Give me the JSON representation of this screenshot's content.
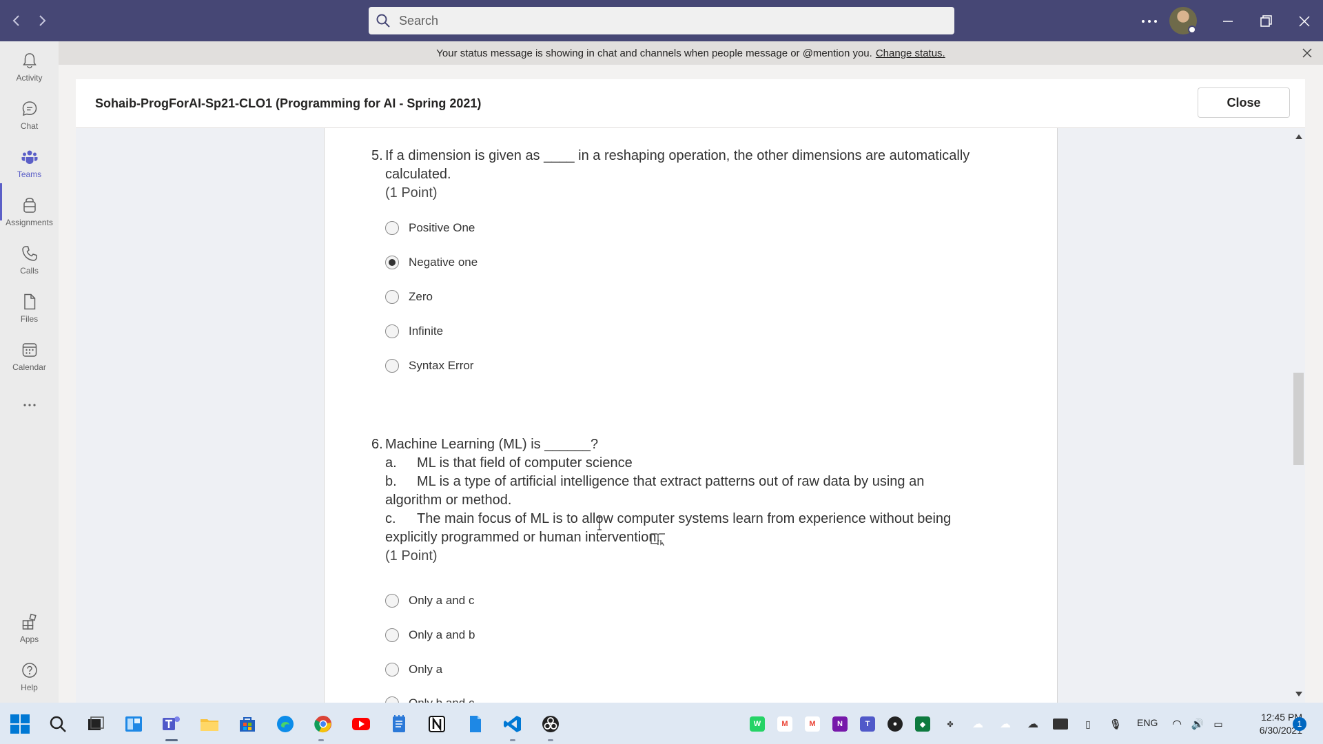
{
  "titlebar": {
    "search_placeholder": "Search"
  },
  "rail": {
    "items": [
      {
        "label": "Activity",
        "icon": "bell-icon"
      },
      {
        "label": "Chat",
        "icon": "chat-icon"
      },
      {
        "label": "Teams",
        "icon": "teams-icon",
        "active": true
      },
      {
        "label": "Assignments",
        "icon": "assignments-icon"
      },
      {
        "label": "Calls",
        "icon": "phone-icon"
      },
      {
        "label": "Files",
        "icon": "file-icon"
      },
      {
        "label": "Calendar",
        "icon": "calendar-icon"
      }
    ],
    "bottom_items": [
      {
        "label": "Apps",
        "icon": "apps-icon"
      },
      {
        "label": "Help",
        "icon": "help-icon"
      }
    ]
  },
  "banner": {
    "text": "Your status message is showing in chat and channels when people message or @mention you.",
    "link": "Change status."
  },
  "modal": {
    "title": "Sohaib-ProgForAI-Sp21-CLO1 (Programming for AI - Spring 2021)",
    "close_label": "Close"
  },
  "questions": [
    {
      "number": "5.",
      "text_line1": "If a dimension is given as ____ in a reshaping operation, the other dimensions are automatically",
      "text_line2": "calculated.",
      "points": "(1 Point)",
      "options": [
        {
          "label": "Positive One",
          "selected": false
        },
        {
          "label": "Negative one",
          "selected": true
        },
        {
          "label": "Zero",
          "selected": false
        },
        {
          "label": "Infinite",
          "selected": false
        },
        {
          "label": "Syntax Error",
          "selected": false
        }
      ]
    },
    {
      "number": "6.",
      "text": "Machine Learning (ML) is ______?",
      "sub": [
        {
          "letter": "a.",
          "text": "ML is that field of computer science"
        },
        {
          "letter": "b.",
          "text": "ML is a type of artificial intelligence that extract patterns out of raw data by using an"
        },
        {
          "letter": "",
          "text": "algorithm or method."
        },
        {
          "letter": "c.",
          "text": "The main focus of ML is to allow computer systems learn from experience without being"
        },
        {
          "letter": "",
          "text": "explicitly programmed or human intervention."
        }
      ],
      "points": "(1 Point)",
      "options": [
        {
          "label": "Only a and c",
          "selected": false
        },
        {
          "label": "Only a and b",
          "selected": false
        },
        {
          "label": "Only a",
          "selected": false
        },
        {
          "label": "Only b and c",
          "selected": false
        }
      ]
    }
  ],
  "taskbar": {
    "language": "ENG",
    "time": "12:45 PM",
    "date": "6/30/2021",
    "notification_count": "1"
  },
  "colors": {
    "titlebar": "#464775",
    "accent": "#5b5fc7"
  }
}
